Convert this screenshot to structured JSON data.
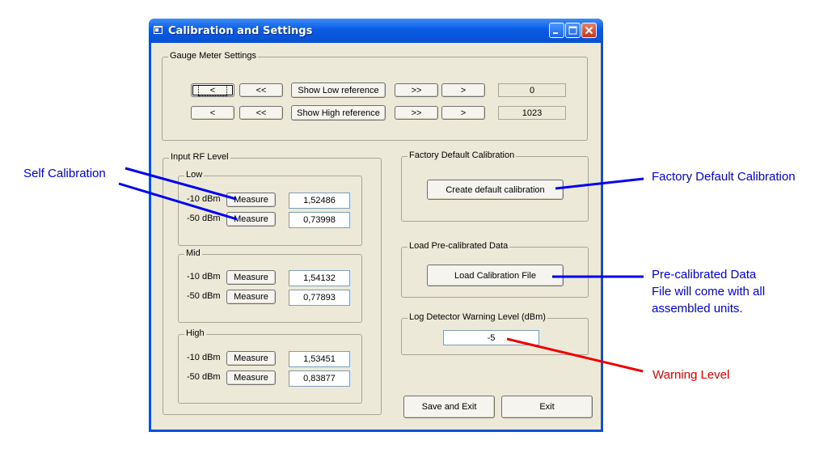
{
  "window": {
    "title": "Calibration and Settings"
  },
  "gauge": {
    "group_label": "Gauge Meter Settings",
    "row_low": {
      "btn1": "<",
      "btn2": "<<",
      "show": "Show Low reference",
      "btn3": ">>",
      "btn4": ">",
      "value": "0"
    },
    "row_high": {
      "btn1": "<",
      "btn2": "<<",
      "show": "Show High reference",
      "btn3": ">>",
      "btn4": ">",
      "value": "1023"
    }
  },
  "input_rf": {
    "group_label": "Input RF Level",
    "measure_label": "Measure",
    "low": {
      "label": "Low",
      "row1_label": "-10 dBm",
      "row1_value": "1,52486",
      "row2_label": "-50 dBm",
      "row2_value": "0,73998"
    },
    "mid": {
      "label": "Mid",
      "row1_label": "-10 dBm",
      "row1_value": "1,54132",
      "row2_label": "-50 dBm",
      "row2_value": "0,77893"
    },
    "high": {
      "label": "High",
      "row1_label": "-10 dBm",
      "row1_value": "1,53451",
      "row2_label": "-50 dBm",
      "row2_value": "0,83877"
    }
  },
  "factory": {
    "group_label": "Factory Default Calibration",
    "button": "Create default calibration"
  },
  "load": {
    "group_label": "Load Pre-calibrated Data",
    "button": "Load Calibration File"
  },
  "warning": {
    "group_label": "Log Detector Warning  Level (dBm)",
    "value": "-5"
  },
  "footer": {
    "save": "Save and Exit",
    "exit": "Exit"
  },
  "annotations": {
    "self_calibration": "Self Calibration",
    "factory_default": "Factory Default Calibration",
    "precal_line1": "Pre-calibrated Data",
    "precal_line2": "File will come with all",
    "precal_line3": "assembled units.",
    "warning_level": "Warning Level",
    "blue": "#0000EE",
    "red": "#EE0000"
  }
}
